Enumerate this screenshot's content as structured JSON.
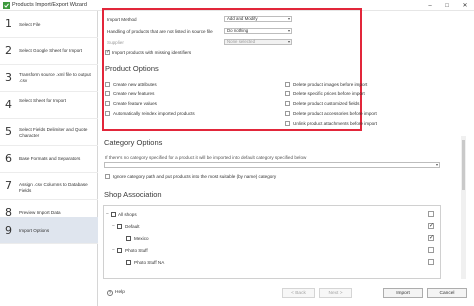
{
  "window": {
    "title": "Products Import/Export Wizard",
    "minimize_glyph": "–",
    "maximize_glyph": "□",
    "close_glyph": "✕"
  },
  "sidebar": {
    "items": [
      {
        "num": "1",
        "label": "Select File",
        "active": false
      },
      {
        "num": "2",
        "label": "Select Google Sheet for Import",
        "active": false
      },
      {
        "num": "3",
        "label": "Transform source .xml file to output .csv",
        "active": false
      },
      {
        "num": "4",
        "label": "Select Sheet for Import",
        "active": false
      },
      {
        "num": "5",
        "label": "Select Fields Delimiter and Quote Character",
        "active": false
      },
      {
        "num": "6",
        "label": "Base Formats and Separators",
        "active": false
      },
      {
        "num": "7",
        "label": "Assign .csv Columns to Database Fields",
        "active": false
      },
      {
        "num": "8",
        "label": "Preview Import Data",
        "active": false
      },
      {
        "num": "9",
        "label": "Import Options",
        "active": true
      }
    ]
  },
  "import_settings": {
    "method_label": "Import Method",
    "method_value": "Add and Modify",
    "handling_label": "Handling of products that are not listed in source file",
    "handling_value": "Do nothing",
    "supplier_label": "Supplier",
    "supplier_value": "None selected",
    "missing_identifiers_label": "Import products with missing identifiers",
    "missing_identifiers_checked": true
  },
  "product_options": {
    "title": "Product Options",
    "left": [
      "Create new attributes",
      "Create new features",
      "Create feature values",
      "Automatically reindex imported products"
    ],
    "right": [
      "Delete product images before import",
      "Delete specific prices before import",
      "Delete product customized fields",
      "Delete product accessories before import",
      "Unlink product attachments before import"
    ]
  },
  "category_options": {
    "title": "Category Options",
    "description": "If there's no category specified for a product it will be imported into default category specified below",
    "ignore_label": "Ignore category path and put products into the most suitable (by name) category"
  },
  "shop_association": {
    "title": "Shop Association",
    "rows": [
      {
        "label": "All shops",
        "level": 0,
        "checked": false,
        "type": "root"
      },
      {
        "label": "Default",
        "level": 1,
        "checked": true,
        "type": "group"
      },
      {
        "label": "Mexico",
        "level": 2,
        "checked": true,
        "type": "shop"
      },
      {
        "label": "Photo Stuff",
        "level": 1,
        "checked": false,
        "type": "group"
      },
      {
        "label": "Photo Stuff NA",
        "level": 2,
        "checked": false,
        "type": "shop"
      }
    ]
  },
  "footer": {
    "help_label": "Help",
    "back_label": "< Back",
    "next_label": "Next >",
    "import_label": "Import",
    "cancel_label": "Cancel"
  },
  "colors": {
    "highlight_box": "#e2263a",
    "active_step_bg": "#dfe5ee"
  }
}
